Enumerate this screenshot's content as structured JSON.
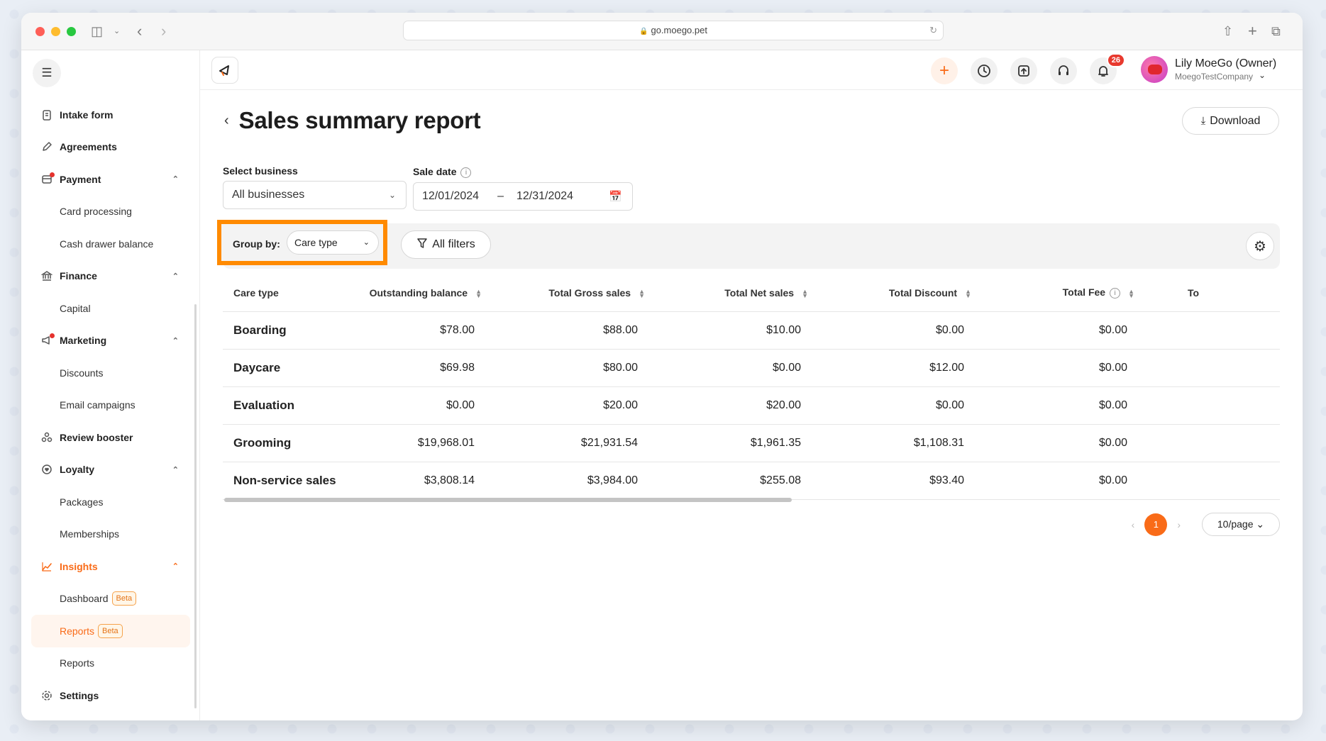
{
  "browser": {
    "url": "go.moego.pet"
  },
  "sidebar": {
    "items": [
      {
        "type": "item",
        "label": "Intake form",
        "icon": "clipboard-icon"
      },
      {
        "type": "item",
        "label": "Agreements",
        "icon": "pen-icon"
      },
      {
        "type": "item",
        "label": "Payment",
        "icon": "payment-icon",
        "expanded": true,
        "dot": true
      },
      {
        "type": "sub",
        "label": "Card processing"
      },
      {
        "type": "sub",
        "label": "Cash drawer balance"
      },
      {
        "type": "item",
        "label": "Finance",
        "icon": "bank-icon",
        "expanded": true
      },
      {
        "type": "sub",
        "label": "Capital"
      },
      {
        "type": "item",
        "label": "Marketing",
        "icon": "megaphone-icon",
        "expanded": true,
        "dot": true
      },
      {
        "type": "sub",
        "label": "Discounts"
      },
      {
        "type": "sub",
        "label": "Email campaigns"
      },
      {
        "type": "item",
        "label": "Review booster",
        "icon": "review-icon"
      },
      {
        "type": "item",
        "label": "Loyalty",
        "icon": "loyalty-icon",
        "expanded": true
      },
      {
        "type": "sub",
        "label": "Packages"
      },
      {
        "type": "sub",
        "label": "Memberships"
      },
      {
        "type": "item",
        "label": "Insights",
        "icon": "chart-line-icon",
        "expanded": true,
        "active": true
      },
      {
        "type": "sub",
        "label": "Dashboard",
        "badge": "Beta"
      },
      {
        "type": "sub",
        "label": "Reports",
        "badge": "Beta",
        "selected": true
      },
      {
        "type": "sub",
        "label": "Reports"
      },
      {
        "type": "item",
        "label": "Settings",
        "icon": "gear-icon"
      }
    ]
  },
  "topbar": {
    "notification_count": "26",
    "user_name": "Lily MoeGo (Owner)",
    "company": "MoegoTestCompany"
  },
  "main": {
    "title": "Sales summary report",
    "download_label": "Download",
    "select_business_label": "Select business",
    "select_business_value": "All businesses",
    "sale_date_label": "Sale date",
    "date_start": "12/01/2024",
    "date_sep": "–",
    "date_end": "12/31/2024",
    "group_by_label": "Group by:",
    "group_by_value": "Care type",
    "all_filters_label": "All filters"
  },
  "table": {
    "columns": [
      "Care type",
      "Outstanding balance",
      "Total Gross sales",
      "Total Net sales",
      "Total Discount",
      "Total Fee",
      "To"
    ],
    "rows": [
      [
        "Boarding",
        "$78.00",
        "$88.00",
        "$10.00",
        "$0.00",
        "$0.00"
      ],
      [
        "Daycare",
        "$69.98",
        "$80.00",
        "$0.00",
        "$12.00",
        "$0.00"
      ],
      [
        "Evaluation",
        "$0.00",
        "$20.00",
        "$20.00",
        "$0.00",
        "$0.00"
      ],
      [
        "Grooming",
        "$19,968.01",
        "$21,931.54",
        "$1,961.35",
        "$1,108.31",
        "$0.00"
      ],
      [
        "Non-service sales",
        "$3,808.14",
        "$3,984.00",
        "$255.08",
        "$93.40",
        "$0.00"
      ]
    ]
  },
  "pagination": {
    "current_page": "1",
    "page_size": "10/page"
  },
  "colors": {
    "accent": "#f96b18",
    "highlight": "#ff8a00"
  }
}
